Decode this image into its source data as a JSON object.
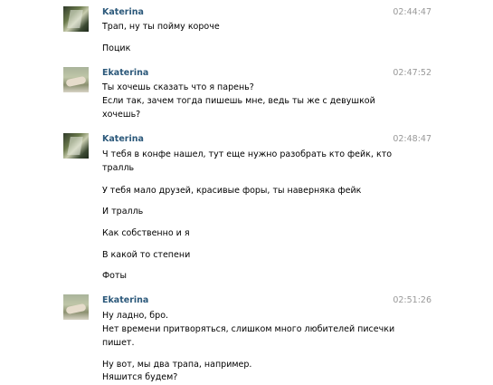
{
  "messages": [
    {
      "author": "Katerina",
      "time": "02:44:47",
      "lines": [
        "Трап, ну ты пойму короче",
        "Поцик"
      ]
    },
    {
      "author": "Ekaterina",
      "time": "02:47:52",
      "lines": [
        "Ты хочешь сказать что я парень?",
        "Если так, зачем тогда пишешь мне, ведь ты же с девушкой хочешь?"
      ]
    },
    {
      "author": "Katerina",
      "time": "02:48:47",
      "lines": [
        "Ч тебя в конфе нашел, тут еще нужно разобрать кто фейк, кто тралль",
        "У тебя мало друзей, красивые форы, ты наверняка фейк",
        "И тралль",
        "Как собственно и я",
        "В какой то степени",
        "Фоты"
      ]
    },
    {
      "author": "Ekaterina",
      "time": "02:51:26",
      "lines": [
        "Ну ладно, бро.",
        "Нет времени притворяться, слишком много любителей писечки пишет.",
        "Ну вот, мы два трапа, например.",
        "Няшится будем?"
      ]
    }
  ]
}
